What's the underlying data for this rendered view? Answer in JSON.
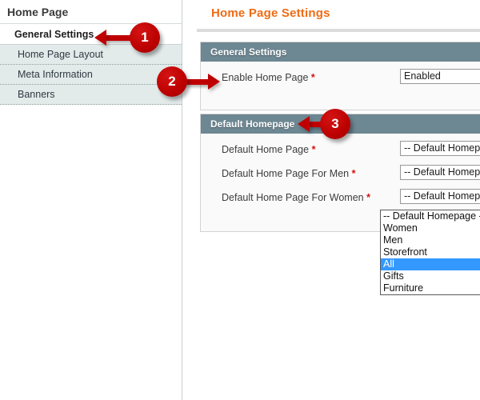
{
  "sidebar": {
    "title": "Home Page",
    "items": [
      {
        "label": "General Settings",
        "active": true
      },
      {
        "label": "Home Page Layout",
        "active": false
      },
      {
        "label": "Meta Information",
        "active": false
      },
      {
        "label": "Banners",
        "active": false
      }
    ]
  },
  "content": {
    "page_title": "Home Page Settings",
    "sections": [
      {
        "header": "General Settings",
        "fields": [
          {
            "label": "Enable Home Page",
            "required": "*",
            "value": "Enabled"
          }
        ]
      },
      {
        "header": "Default Homepage",
        "fields": [
          {
            "label": "Default Home Page",
            "required": "*",
            "value": "-- Default Homepage -"
          },
          {
            "label": "Default Home Page For Men",
            "required": "*",
            "value": "-- Default Homepage -"
          },
          {
            "label": "Default Home Page For Women",
            "required": "*",
            "value": "-- Default Homepage -"
          }
        ]
      }
    ]
  },
  "dropdown": {
    "options": [
      {
        "label": "-- Default Homepage -",
        "selected": false
      },
      {
        "label": "Women",
        "selected": false
      },
      {
        "label": "Men",
        "selected": false
      },
      {
        "label": "Storefront",
        "selected": false
      },
      {
        "label": "All",
        "selected": true
      },
      {
        "label": "Gifts",
        "selected": false
      },
      {
        "label": "Furniture",
        "selected": false
      }
    ]
  },
  "callouts": [
    {
      "number": "1",
      "direction": "left"
    },
    {
      "number": "2",
      "direction": "right"
    },
    {
      "number": "3",
      "direction": "left"
    }
  ],
  "colors": {
    "accent_orange": "#ef6b15",
    "panel_header": "#6d8793",
    "callout_red": "#c00000",
    "selection_blue": "#3399ff",
    "required_red": "#d81111"
  }
}
